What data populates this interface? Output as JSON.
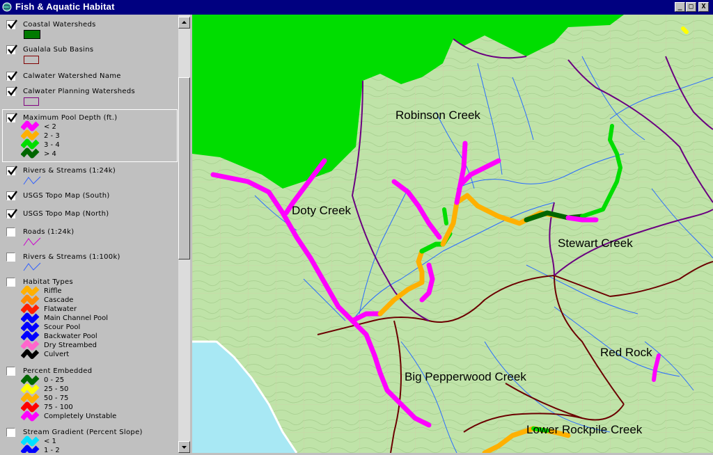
{
  "window": {
    "title": "Fish & Aquatic Habitat",
    "icon": "globe-icon",
    "controls": [
      "_",
      "□",
      "X"
    ]
  },
  "legend": {
    "layers": [
      {
        "name": "Coastal Watersheds",
        "checked": true,
        "symbol": "fill",
        "color": "#007a00",
        "border": "#000000"
      },
      {
        "name": "Gualala Sub Basins",
        "checked": true,
        "symbol": "outline",
        "color": "#800000"
      },
      {
        "name": "Calwater Watershed Name",
        "checked": true,
        "symbol": "none"
      },
      {
        "name": "Calwater Planning Watersheds",
        "checked": true,
        "symbol": "outline",
        "color": "#800080"
      },
      {
        "name": "Maximum Pool Depth (ft.)",
        "checked": true,
        "symbol": "classes",
        "selected": true,
        "classes": [
          {
            "label": "< 2",
            "color": "#ff00ff"
          },
          {
            "label": "2 - 3",
            "color": "#ffb000"
          },
          {
            "label": "3 - 4",
            "color": "#00dd00"
          },
          {
            "label": "> 4",
            "color": "#006600"
          }
        ]
      },
      {
        "name": "Rivers & Streams (1:24k)",
        "checked": true,
        "symbol": "line",
        "color": "#3060ff"
      },
      {
        "name": "USGS Topo Map (South)",
        "checked": true,
        "symbol": "none"
      },
      {
        "name": "USGS Topo Map (North)",
        "checked": true,
        "symbol": "none"
      },
      {
        "name": "Roads (1:24k)",
        "checked": false,
        "symbol": "line",
        "color": "#cc00cc"
      },
      {
        "name": "Rivers & Streams (1:100k)",
        "checked": false,
        "symbol": "line",
        "color": "#3060ff"
      },
      {
        "name": "Habitat Types",
        "checked": false,
        "symbol": "classes",
        "classes": [
          {
            "label": "Riffle",
            "color": "#ffb000"
          },
          {
            "label": "Cascade",
            "color": "#ff8c00"
          },
          {
            "label": "Flatwater",
            "color": "#ff2000"
          },
          {
            "label": "Main Channel Pool",
            "color": "#0000ff"
          },
          {
            "label": "Scour Pool",
            "color": "#0000ff"
          },
          {
            "label": "Backwater Pool",
            "color": "#0000ff"
          },
          {
            "label": "Dry Streambed",
            "color": "#ff66cc"
          },
          {
            "label": "Culvert",
            "color": "#000000"
          }
        ]
      },
      {
        "name": "Percent Embedded",
        "checked": false,
        "symbol": "classes",
        "classes": [
          {
            "label": "0 - 25",
            "color": "#006600"
          },
          {
            "label": "25 - 50",
            "color": "#ffff00"
          },
          {
            "label": "50 - 75",
            "color": "#ffb000"
          },
          {
            "label": "75 - 100",
            "color": "#ff0000"
          },
          {
            "label": "Completely Unstable",
            "color": "#ff00ff"
          }
        ]
      },
      {
        "name": "Stream Gradient (Percent Slope)",
        "checked": false,
        "symbol": "classes",
        "classes": [
          {
            "label": "< 1",
            "color": "#00e0ff"
          },
          {
            "label": "1 - 2",
            "color": "#0000ff"
          }
        ]
      }
    ]
  },
  "map": {
    "labels": [
      "Robinson Creek",
      "Doty Creek",
      "Stewart Creek",
      "Red Rock",
      "Big Pepperwood Creek",
      "Lower Rockpile Creek"
    ],
    "colors": {
      "outside": "#00dd00",
      "topo": "#bfe3a8",
      "ocean": "#a8e8f4",
      "calwater": "#6a0080",
      "subbasin": "#6b0000",
      "stream": "#2a6cff"
    }
  }
}
